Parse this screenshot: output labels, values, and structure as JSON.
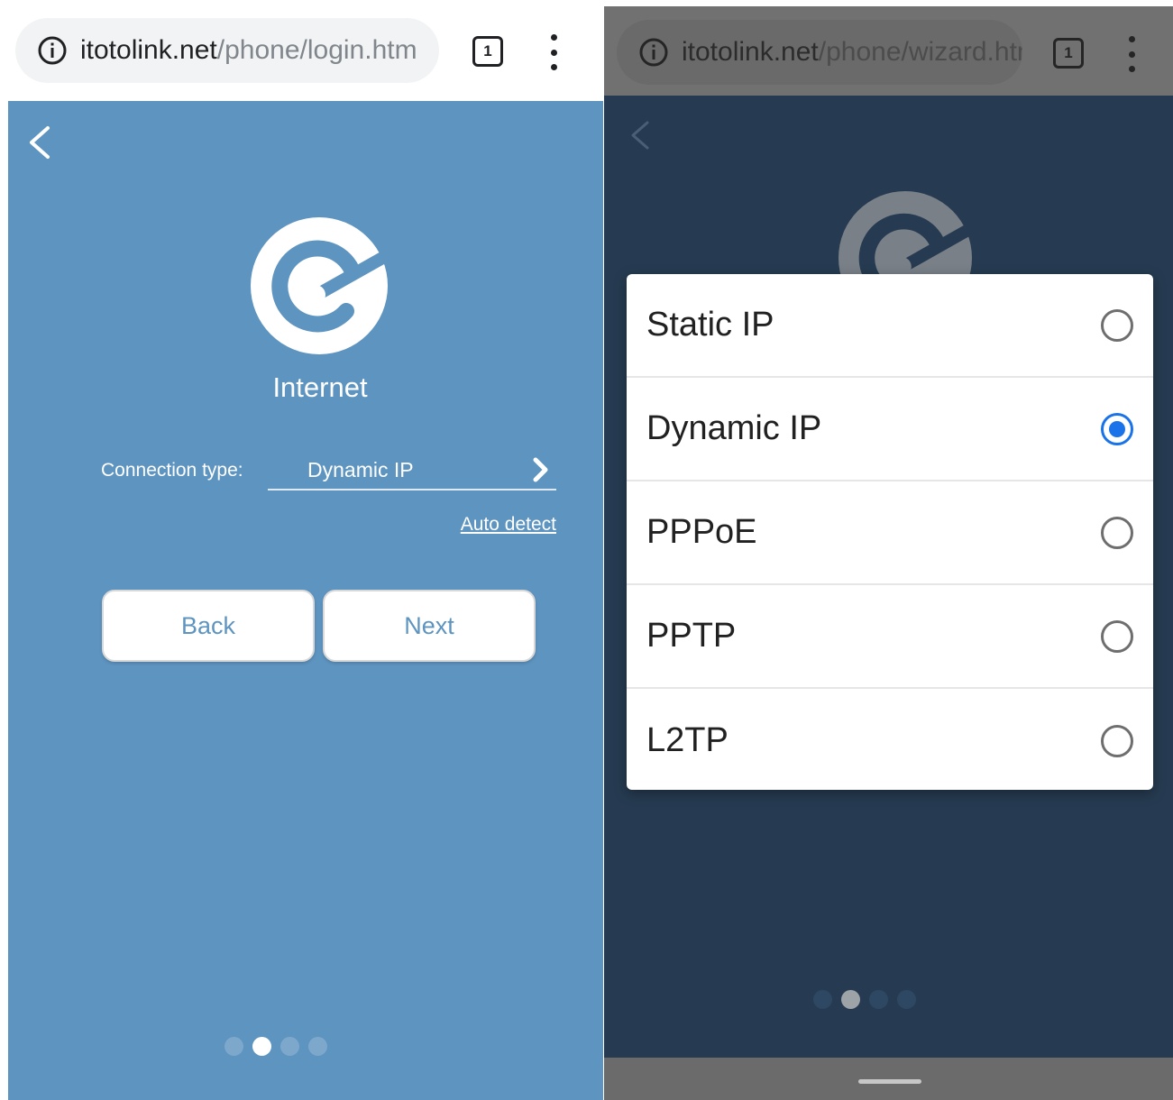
{
  "left": {
    "browser": {
      "url_domain": "itotolink.net",
      "url_path": "/phone/login.htm",
      "tab_count": "1"
    },
    "page": {
      "title": "Internet",
      "connection_label": "Connection type:",
      "connection_value": "Dynamic IP",
      "auto_detect": "Auto detect",
      "back_label": "Back",
      "next_label": "Next",
      "pager": {
        "count": 4,
        "active": 2
      }
    }
  },
  "right": {
    "browser": {
      "url_domain": "itotolink.net",
      "url_path": "/phone/wizard.htm",
      "tab_count": "1"
    },
    "dialog": {
      "options": [
        {
          "label": "Static IP",
          "selected": false
        },
        {
          "label": "Dynamic IP",
          "selected": true
        },
        {
          "label": "PPPoE",
          "selected": false
        },
        {
          "label": "PPTP",
          "selected": false
        },
        {
          "label": "L2TP",
          "selected": false
        }
      ]
    },
    "pager": {
      "count": 4,
      "active": 2
    }
  },
  "colors": {
    "page_blue": "#5e94c0",
    "page_dark": "#263b51",
    "radio_selected": "#1a73e8"
  }
}
